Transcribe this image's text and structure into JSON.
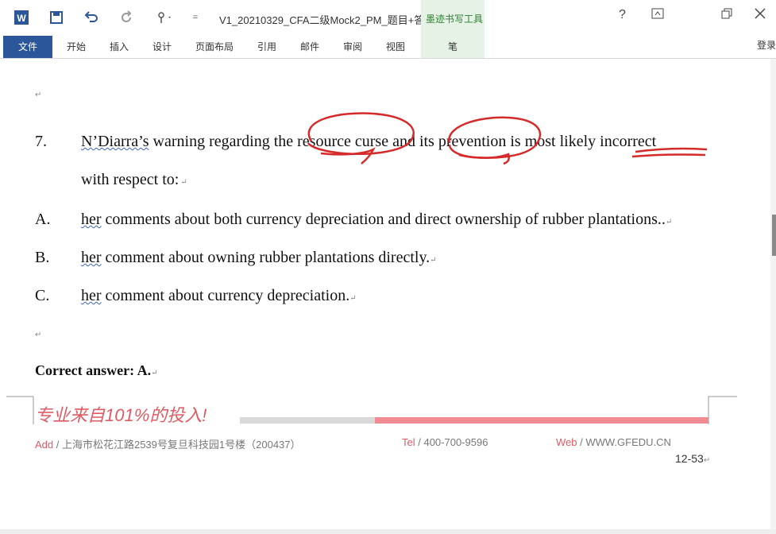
{
  "titlebar": {
    "document_title": "V1_20210329_CFA二级Mock2_PM_题目+答...",
    "ink_tool_title": "墨迹书写工具",
    "help": "?",
    "qat_more": "="
  },
  "ribbon": {
    "tabs": [
      "文件",
      "开始",
      "插入",
      "设计",
      "页面布局",
      "引用",
      "邮件",
      "审阅",
      "视图"
    ],
    "pen_tab": "笔",
    "login": "登录"
  },
  "question": {
    "number": "7.",
    "line1": {
      "name": "N’Diarra’s",
      "text": " warning regarding the resource curse and its prevention is most likely incorrect"
    },
    "line2": "with respect to:",
    "options": [
      {
        "letter": "A.",
        "first": "her",
        "rest": " comments about both currency depreciation and direct ownership of rubber plantations.."
      },
      {
        "letter": "B.",
        "first": "her",
        "rest": " comment about owning rubber plantations directly."
      },
      {
        "letter": "C.",
        "first": "her",
        "rest": " comment about currency depreciation."
      }
    ],
    "correct": "Correct answer: A."
  },
  "footer": {
    "slogan": "专业来自101%的投入!",
    "add_label": "Add",
    "address": " / 上海市松花江路2539号复旦科技园1号楼（200437）",
    "tel_label": "Tel",
    "tel": " / 400-700-9596",
    "web_label": "Web",
    "web": " / WWW.GFEDU.CN",
    "page": "12-53"
  },
  "colors": {
    "file_tab": "#2b579a",
    "ink": "#d42a2a",
    "slogan": "#e05a64",
    "pen_tab": "#e6f2e6"
  },
  "icons": [
    "word-logo-icon",
    "save-icon",
    "undo-icon",
    "redo-icon",
    "touch-mode-icon",
    "restore-ribbon-icon",
    "maximize-icon",
    "close-icon"
  ]
}
